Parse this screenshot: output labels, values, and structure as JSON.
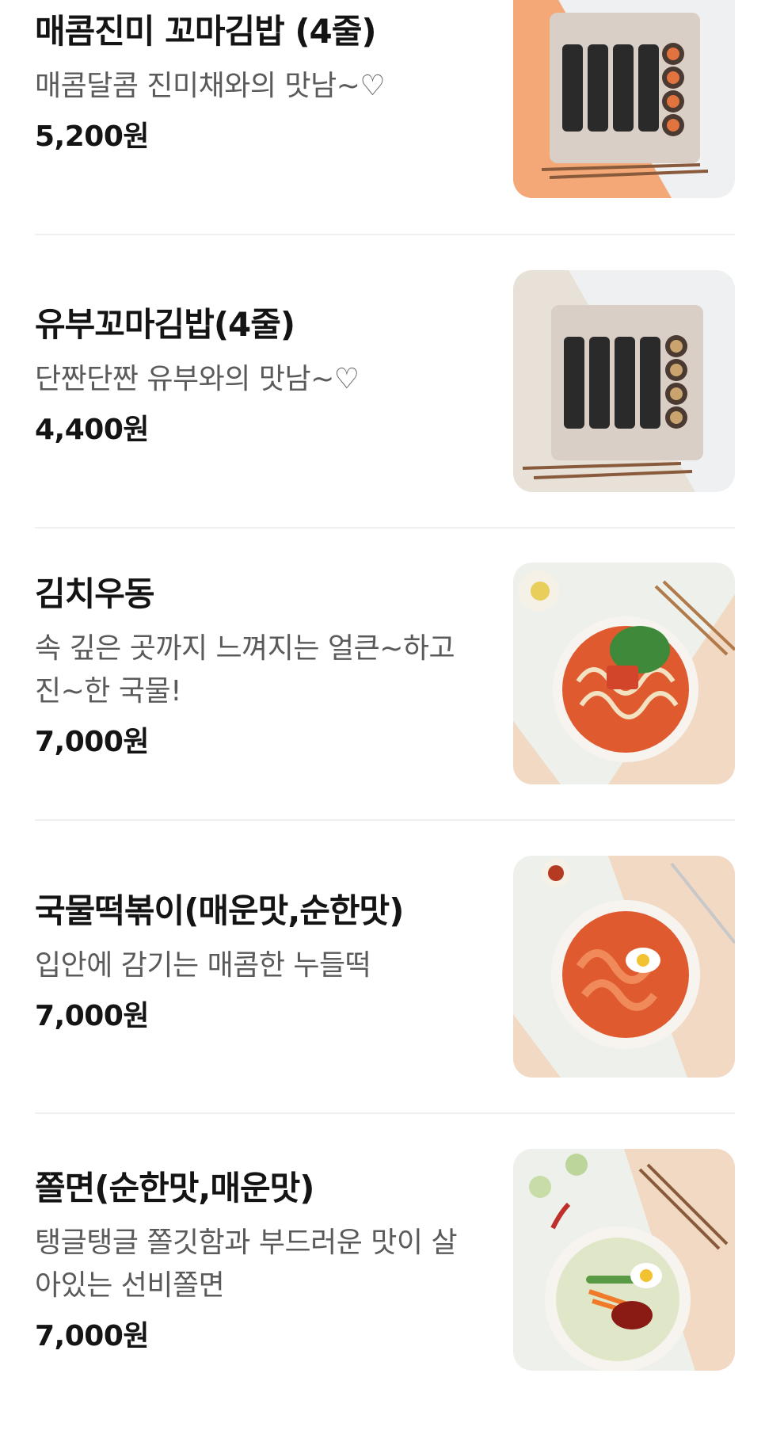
{
  "menu": {
    "items": [
      {
        "name": "매콤진미 꼬마김밥 (4줄)",
        "description": "매콤달콤 진미채와의 맛남~♡",
        "price": "5,200원",
        "image": "spicy-mini-kimbap-photo"
      },
      {
        "name": "유부꼬마김밥(4줄)",
        "description": "단짠단짠 유부와의 맛남~♡",
        "price": "4,400원",
        "image": "yubu-mini-kimbap-photo"
      },
      {
        "name": "김치우동",
        "description": "속 깊은 곳까지 느껴지는 얼큰~하고 진~한 국물!",
        "price": "7,000원",
        "image": "kimchi-udon-photo"
      },
      {
        "name": "국물떡볶이(매운맛,순한맛)",
        "description": "입안에 감기는 매콤한 누들떡",
        "price": "7,000원",
        "image": "soup-tteokbokki-photo"
      },
      {
        "name": "쫄면(순한맛,매운맛)",
        "description": "탱글탱글 쫄깃함과 부드러운 맛이 살아있는 선비쫄면",
        "price": "7,000원",
        "image": "jjolmyeon-photo"
      }
    ]
  },
  "colors": {
    "peach": "#f4a878",
    "beige": "#f2d9c3",
    "tray": "#d9cfc6",
    "seaweed": "#2a2a2a",
    "soup": "#e05a30",
    "divider": "#f0f0f0"
  }
}
